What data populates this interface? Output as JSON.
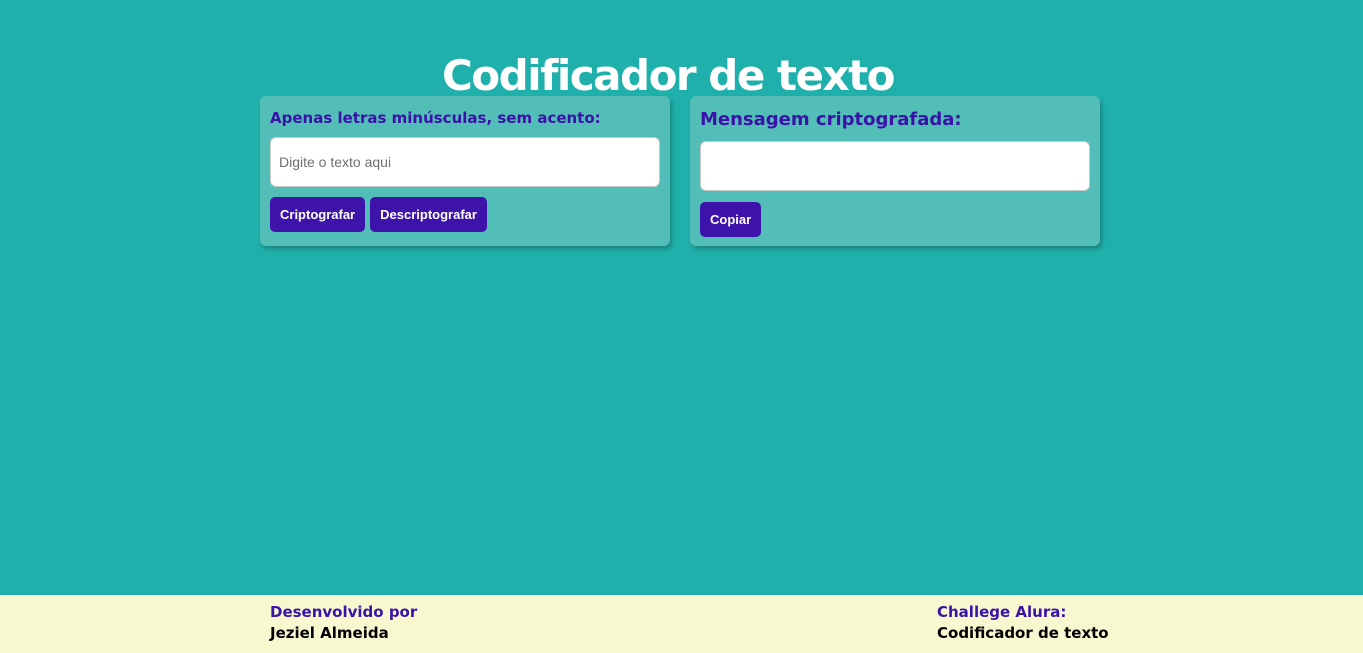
{
  "header": {
    "title": "Codificador de texto"
  },
  "input_card": {
    "label": "Apenas letras minúsculas, sem acento:",
    "input_placeholder": "Digite o texto aqui",
    "input_value": "",
    "encrypt_button": "Criptografar",
    "decrypt_button": "Descriptografar"
  },
  "output_card": {
    "label": "Mensagem criptografada:",
    "output_value": "",
    "copy_button": "Copiar"
  },
  "footer": {
    "left_heading": "Desenvolvido por",
    "left_text": "Jeziel Almeida",
    "right_heading": "Challege Alura:",
    "right_text": "Codificador de texto"
  },
  "colors": {
    "background": "#20b0ab",
    "card": "#53bdb8",
    "accent": "#3d13aa",
    "footer": "#f7f8d0"
  }
}
